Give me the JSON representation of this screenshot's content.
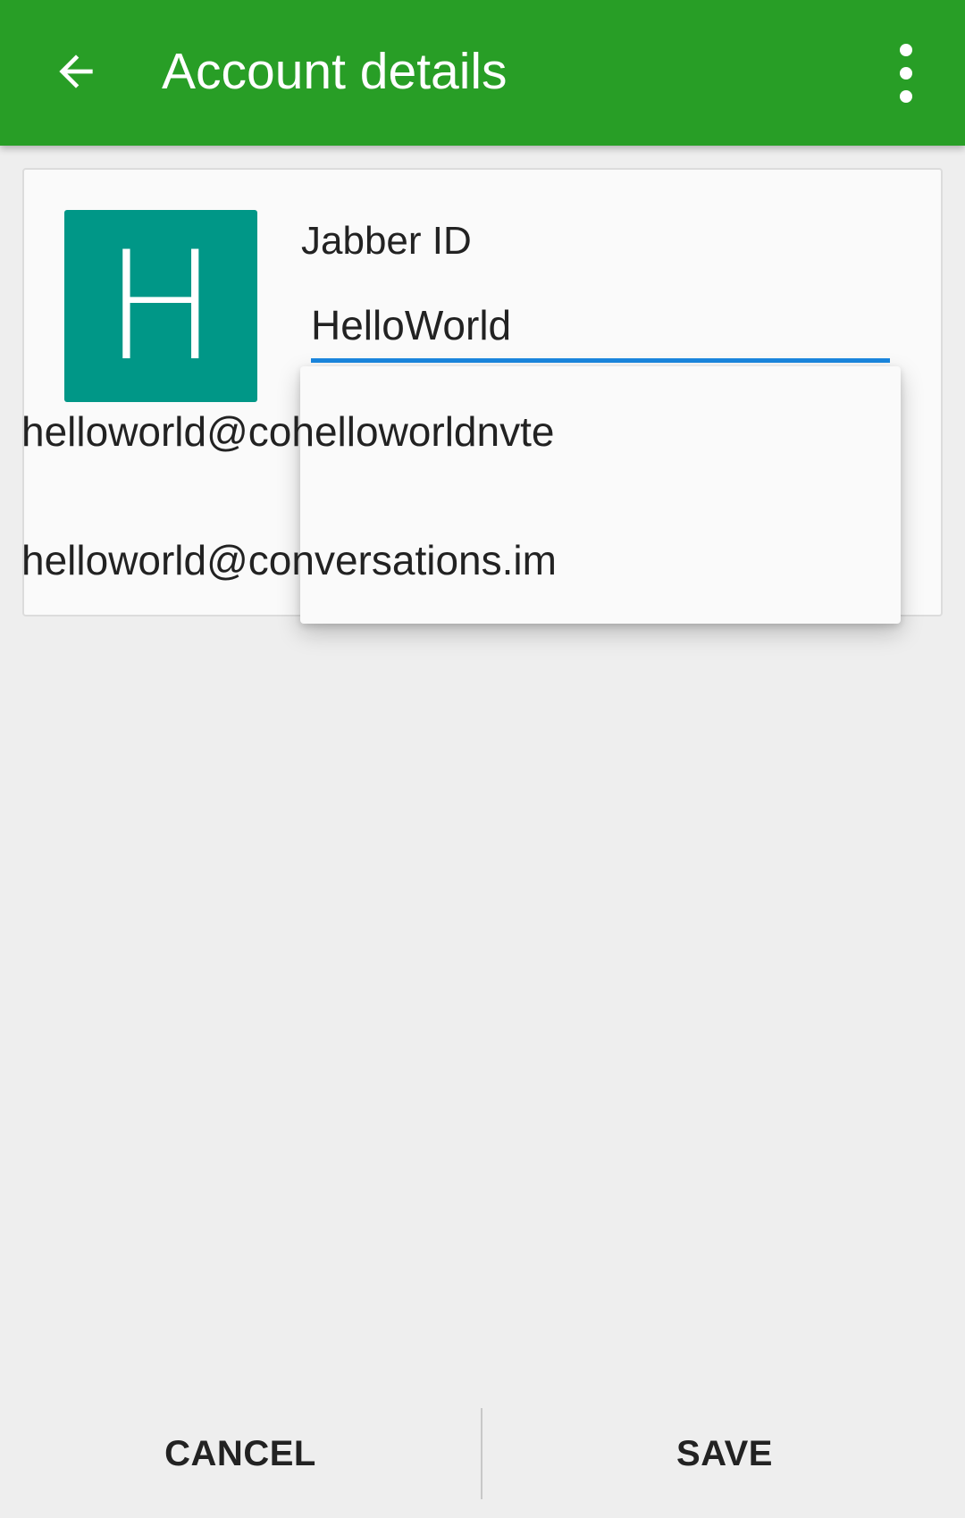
{
  "app_bar": {
    "title": "Account details",
    "back_icon": "arrow-left-icon",
    "overflow_icon": "more-vert-icon",
    "color": "#289e26"
  },
  "account": {
    "avatar_letter": "H",
    "avatar_color": "#009787",
    "jabber_label": "Jabber ID",
    "jabber_value": "HelloWorld"
  },
  "suggestions": [
    "helloworld@cohelloworldnvte",
    "helloworld@conversations.im"
  ],
  "footer": {
    "cancel_label": "CANCEL",
    "save_label": "SAVE"
  }
}
